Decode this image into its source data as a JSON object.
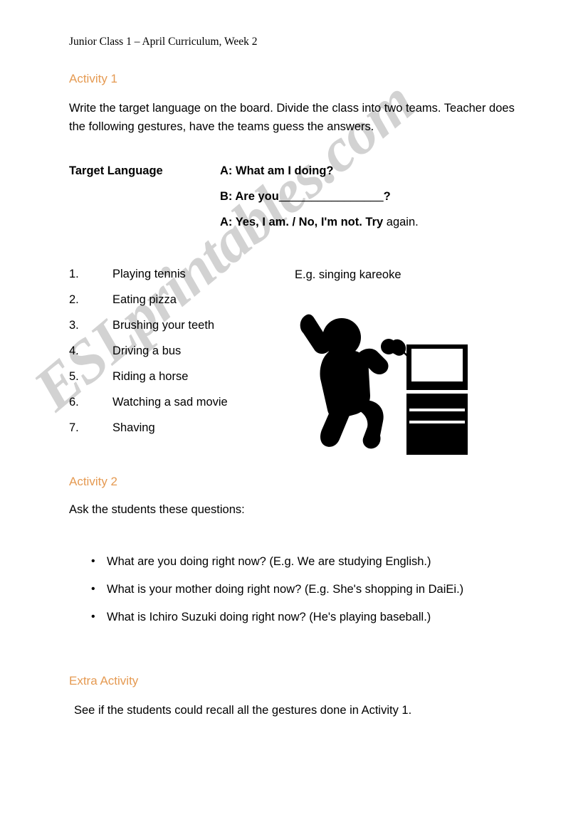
{
  "document": {
    "header": "Junior Class 1 – April Curriculum, Week 2",
    "watermark": "ESLprintables.com",
    "watermark_color": "#d2d2d2",
    "heading_color": "#e59a52",
    "body_color": "#000000",
    "background_color": "#ffffff"
  },
  "activity1": {
    "heading": "Activity 1",
    "intro": "Write the target language on the board. Divide the class into two teams. Teacher does the following gestures, have the teams guess the answers.",
    "target_language": {
      "label": "Target Language",
      "line1": "A: What am I doing?",
      "line2_prefix": "B: Are you",
      "line2_blank": "________________",
      "line2_suffix": "?",
      "line3_bold": "A: Yes, I am. / No, I'm not. Try",
      "line3_normal": " again."
    },
    "gestures": [
      {
        "number": "1.",
        "label": "Playing tennis"
      },
      {
        "number": "2.",
        "label": "Eating pizza"
      },
      {
        "number": "3.",
        "label": "Brushing your teeth"
      },
      {
        "number": "4.",
        "label": "Driving a bus"
      },
      {
        "number": "5.",
        "label": "Riding a horse"
      },
      {
        "number": "6.",
        "label": "Watching a sad movie"
      },
      {
        "number": "7.",
        "label": "Shaving"
      }
    ],
    "example_caption": "E.g. singing kareoke",
    "illustration_name": "karaoke-singer-silhouette"
  },
  "activity2": {
    "heading": "Activity 2",
    "intro": "Ask the students these questions:",
    "bullet_glyph": "•",
    "questions": [
      "What are you doing right now? (E.g. We are studying English.)",
      "What is your mother doing right now? (E.g. She's shopping in DaiEi.)",
      "What is Ichiro Suzuki doing right now? (He's playing baseball.)"
    ]
  },
  "extra_activity": {
    "heading": "Extra Activity",
    "text": "See if the students could recall all the gestures done in Activity 1."
  }
}
